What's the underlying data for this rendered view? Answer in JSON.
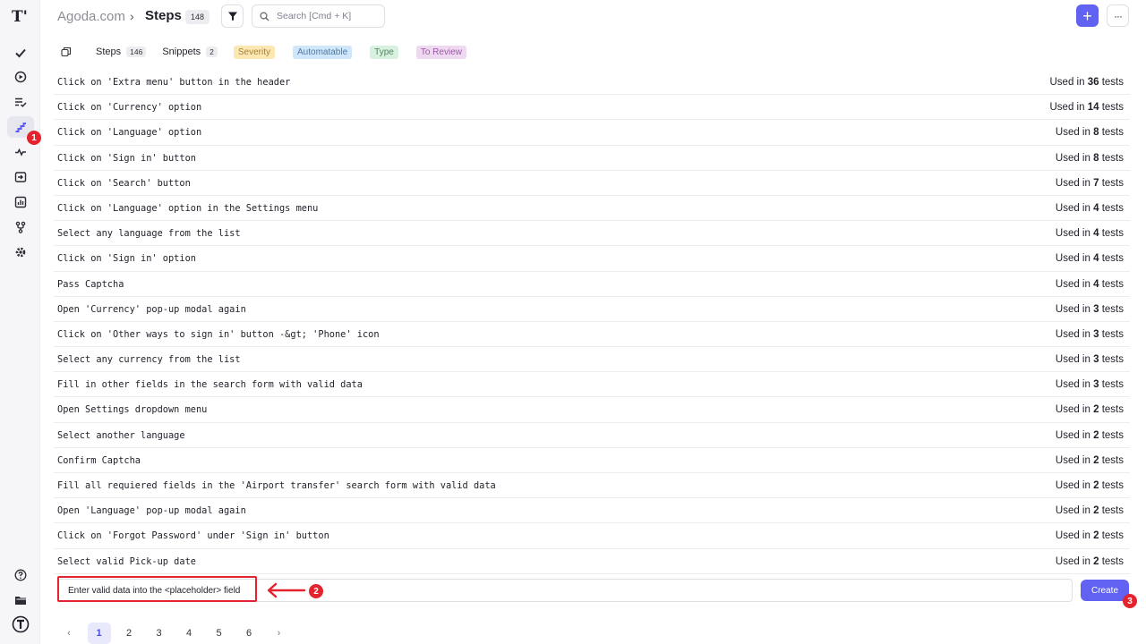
{
  "header": {
    "project": "Agoda.com",
    "separator": "›",
    "title": "Steps",
    "count": "148",
    "search_placeholder": "Search [Cmd + K]",
    "add_label": "+",
    "more_label": "···"
  },
  "sidebar": {
    "logo": "T'",
    "items": [
      {
        "name": "check-icon"
      },
      {
        "name": "play-icon"
      },
      {
        "name": "run-list-icon"
      },
      {
        "name": "steps-icon"
      },
      {
        "name": "pulse-icon"
      },
      {
        "name": "import-icon"
      },
      {
        "name": "analytics-icon"
      },
      {
        "name": "branches-icon"
      },
      {
        "name": "settings-icon"
      }
    ],
    "bottom": [
      {
        "name": "help-icon"
      },
      {
        "name": "folder-icon"
      },
      {
        "name": "testomat-logo-icon"
      }
    ]
  },
  "annotations": {
    "one": "1",
    "two": "2",
    "three": "3",
    "color": "#e5232e"
  },
  "tabs": {
    "steps_label": "Steps",
    "steps_count": "146",
    "snippets_label": "Snippets",
    "snippets_count": "2",
    "tags": {
      "severity": "Severity",
      "automatable": "Automatable",
      "type": "Type",
      "review": "To Review"
    }
  },
  "used_prefix": "Used in",
  "used_suffix": "tests",
  "steps": [
    {
      "text": "Click on 'Extra menu' button in the header",
      "count": "36"
    },
    {
      "text": "Click on 'Currency' option",
      "count": "14"
    },
    {
      "text": "Click on 'Language' option",
      "count": "8"
    },
    {
      "text": "Click on 'Sign in' button",
      "count": "8"
    },
    {
      "text": "Click on 'Search' button",
      "count": "7"
    },
    {
      "text": "Click on 'Language' option in the Settings menu",
      "count": "4"
    },
    {
      "text": "Select any language from the list",
      "count": "4"
    },
    {
      "text": "Click on 'Sign in' option",
      "count": "4"
    },
    {
      "text": "Pass Captcha",
      "count": "4"
    },
    {
      "text": "Open 'Currency' pop-up modal again",
      "count": "3"
    },
    {
      "text": "Click on 'Other ways to sign in' button -&gt; 'Phone' icon",
      "count": "3"
    },
    {
      "text": "Select any currency from the list",
      "count": "3"
    },
    {
      "text": "Fill in other fields in the search form with valid data",
      "count": "3"
    },
    {
      "text": "Open Settings dropdown menu",
      "count": "2"
    },
    {
      "text": "Select another language",
      "count": "2"
    },
    {
      "text": "Confirm Captcha",
      "count": "2"
    },
    {
      "text": "Fill all requiered fields in the 'Airport transfer' search form with valid data",
      "count": "2"
    },
    {
      "text": "Open 'Language' pop-up modal again",
      "count": "2"
    },
    {
      "text": "Click on 'Forgot Password' under 'Sign in' button",
      "count": "2"
    },
    {
      "text": "Select valid Pick-up date",
      "count": "2"
    }
  ],
  "create": {
    "input_value": "Enter valid data into the <placeholder> field",
    "button_label": "Create"
  },
  "pagination": {
    "prev": "‹",
    "next": "›",
    "pages": [
      "1",
      "2",
      "3",
      "4",
      "5",
      "6"
    ],
    "current": "1"
  }
}
